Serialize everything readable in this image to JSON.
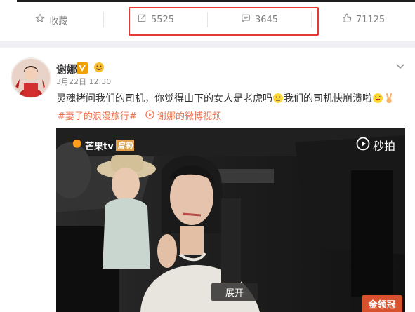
{
  "top_actions": {
    "favorite_label": "收藏",
    "repost_count": "5525",
    "comment_count": "3645",
    "like_count": "71125"
  },
  "post": {
    "username": "谢娜",
    "time": "3月22日 12:30",
    "text_part1": "灵魂拷问我们的司机，你觉得山下的女人是老虎吗",
    "text_part2": "我们的司机快崩溃啦",
    "topic_tag": "#妻子的浪漫旅行#",
    "video_tag": "谢娜的微博视频"
  },
  "video": {
    "source_logo_text": "芒果tv",
    "source_logo_sub": "自制",
    "platform_logo_text": "秒拍",
    "expand_label": "展开",
    "stamp_text": "金领冠"
  },
  "colors": {
    "highlight_border": "#e53935",
    "tag_color": "#eb7350",
    "verified_badge": "#f0a000"
  }
}
